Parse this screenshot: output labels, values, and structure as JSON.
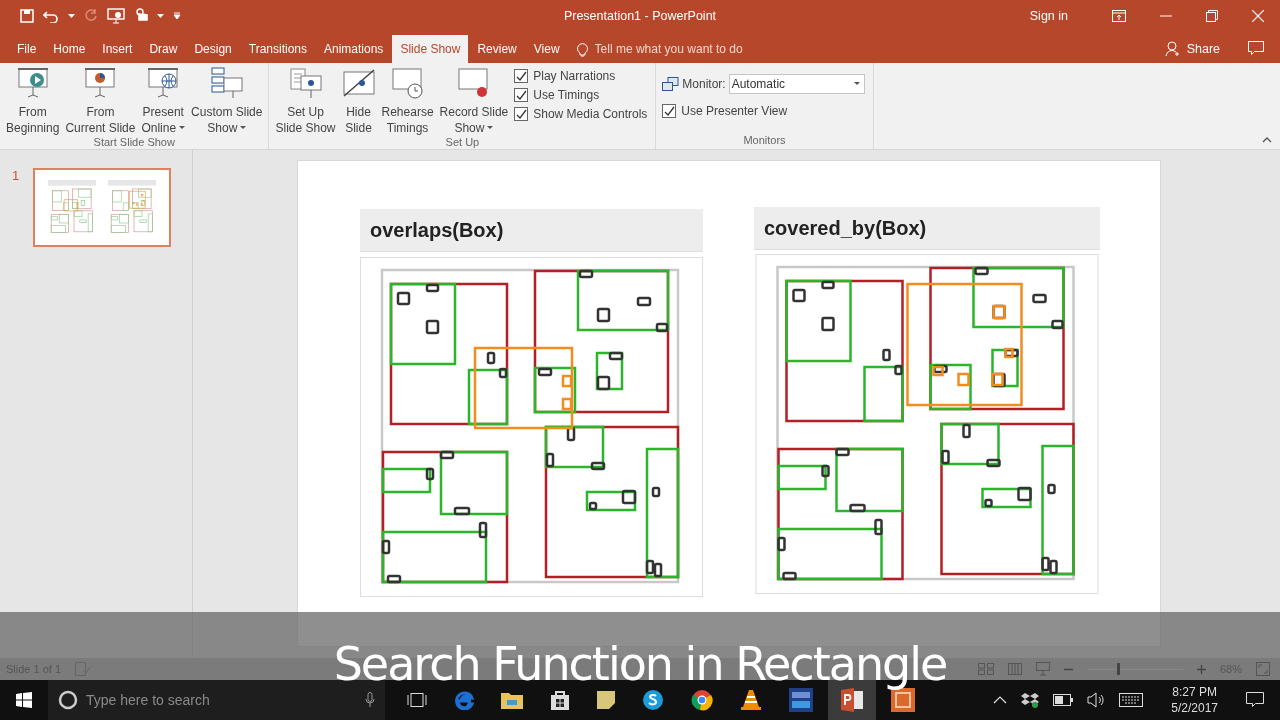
{
  "window": {
    "title": "Presentation1  -  PowerPoint",
    "sign_in": "Sign in"
  },
  "tabs": [
    {
      "label": "File",
      "selected": false
    },
    {
      "label": "Home",
      "selected": false
    },
    {
      "label": "Insert",
      "selected": false
    },
    {
      "label": "Draw",
      "selected": false
    },
    {
      "label": "Design",
      "selected": false
    },
    {
      "label": "Transitions",
      "selected": false
    },
    {
      "label": "Animations",
      "selected": false
    },
    {
      "label": "Slide Show",
      "selected": true
    },
    {
      "label": "Review",
      "selected": false
    },
    {
      "label": "View",
      "selected": false
    }
  ],
  "tell_me": {
    "placeholder": "Tell me what you want to do"
  },
  "share": {
    "label": "Share"
  },
  "ribbon": [
    {
      "label": "Start Slide Show",
      "items": [
        {
          "kind": "button",
          "lines": [
            "From",
            "Beginning"
          ],
          "dropdown": false
        },
        {
          "kind": "button",
          "lines": [
            "From",
            "Current Slide"
          ],
          "dropdown": false
        },
        {
          "kind": "button",
          "lines": [
            "Present",
            "Online"
          ],
          "dropdown": true
        },
        {
          "kind": "button",
          "lines": [
            "Custom Slide",
            "Show"
          ],
          "dropdown": true
        }
      ]
    },
    {
      "label": "Set Up",
      "items": [
        {
          "kind": "button",
          "lines": [
            "Set Up",
            "Slide Show"
          ],
          "dropdown": false
        },
        {
          "kind": "button",
          "lines": [
            "Hide",
            "Slide"
          ],
          "dropdown": false
        },
        {
          "kind": "button",
          "lines": [
            "Rehearse",
            "Timings"
          ],
          "dropdown": false
        },
        {
          "kind": "button",
          "lines": [
            "Record Slide",
            "Show"
          ],
          "dropdown": true
        },
        {
          "kind": "checks",
          "options": [
            {
              "label": "Play Narrations",
              "checked": true
            },
            {
              "label": "Use Timings",
              "checked": true
            },
            {
              "label": "Show Media Controls",
              "checked": true
            }
          ]
        }
      ]
    },
    {
      "label": "Monitors",
      "items": [
        {
          "kind": "monitor",
          "label": "Monitor:",
          "value": "Automatic",
          "options": [
            {
              "label": "Use Presenter View",
              "checked": true
            }
          ]
        }
      ]
    }
  ],
  "thumbnails": [
    {
      "number": "1",
      "selected": true
    }
  ],
  "slide": {
    "panels": [
      {
        "title": "overlaps(Box)"
      },
      {
        "title": "covered_by(Box)"
      }
    ]
  },
  "status_bar": {
    "slide_info": "Slide 1 of 1",
    "zoom": {
      "level": 0.32,
      "reading": "68%"
    }
  },
  "caption": "Search Function in Rectangle",
  "taskbar": {
    "search": {
      "placeholder": "Type here to search"
    },
    "time": "8:27 PM",
    "date": "5/2/2017"
  }
}
